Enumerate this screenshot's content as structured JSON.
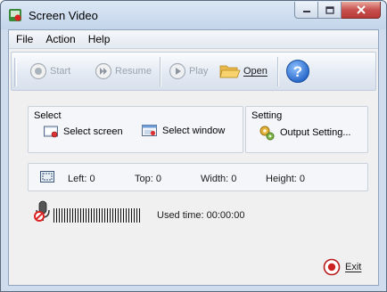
{
  "window": {
    "title": "Screen Video",
    "controls": [
      "minimize-icon",
      "maximize-icon",
      "close-icon"
    ]
  },
  "menu": {
    "items": [
      {
        "label": "File"
      },
      {
        "label": "Action"
      },
      {
        "label": "Help"
      }
    ]
  },
  "toolbar": {
    "start_label": "Start",
    "resume_label": "Resume",
    "play_label": "Play",
    "open_label": "Open"
  },
  "select_group": {
    "title": "Select",
    "screen_label": "Select screen",
    "window_label": "Select window"
  },
  "setting_group": {
    "title": "Setting",
    "output_label": "Output Setting..."
  },
  "info": {
    "left": "Left:  0",
    "top": "Top:  0",
    "width": "Width:  0",
    "height": "Height:  0"
  },
  "status": {
    "used_time": "Used time:  00:00:00"
  },
  "footer": {
    "exit_label": "Exit"
  },
  "colors": {
    "accent": "#2f6fd0",
    "record_red": "#cc2222",
    "disabled_text": "#9aa3ad"
  }
}
